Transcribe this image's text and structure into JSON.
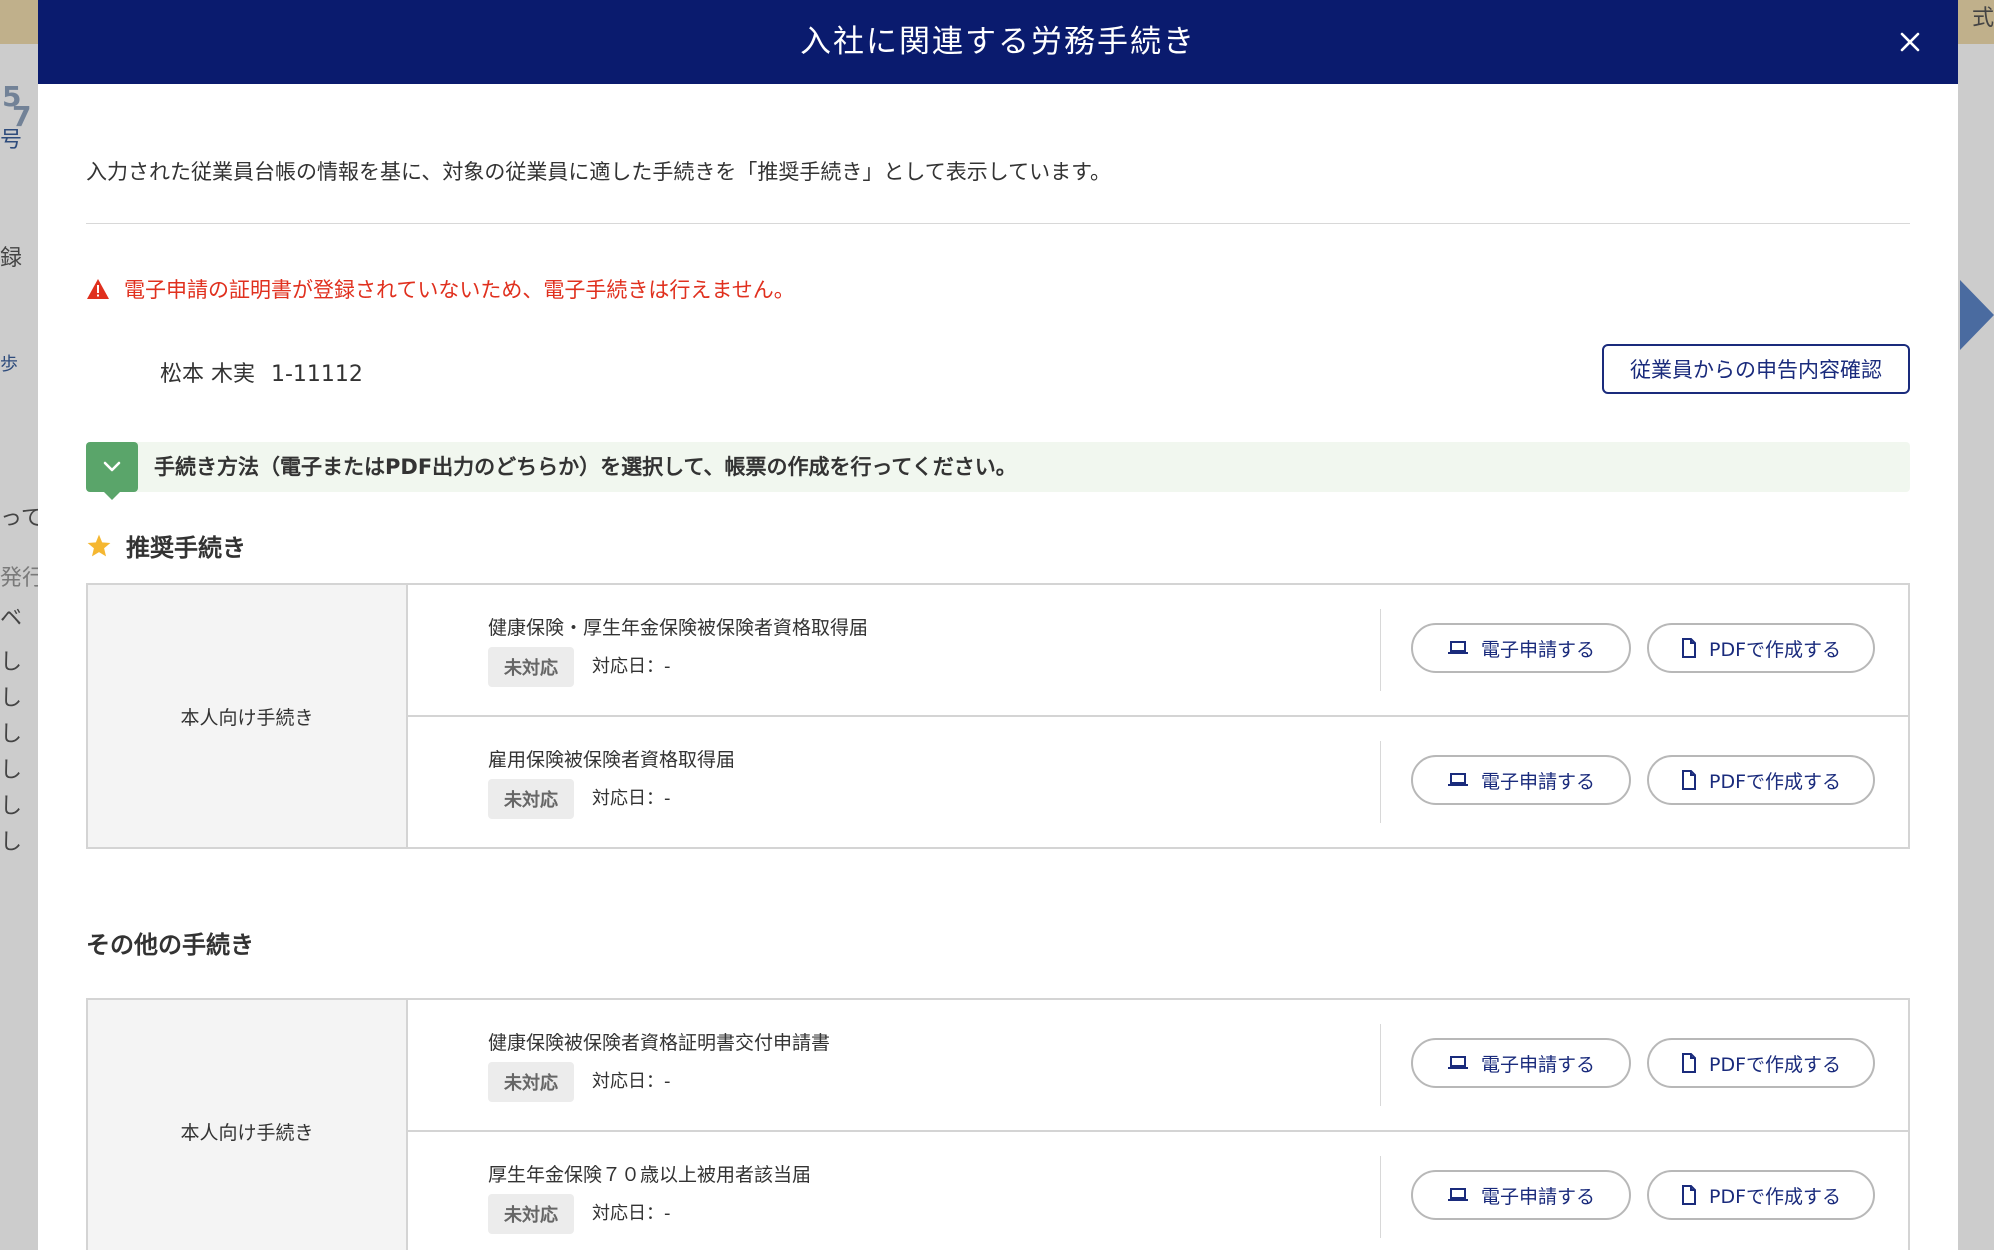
{
  "colors": {
    "header_bg": "#0a1b6e",
    "accent": "#1a2b7c",
    "warning": "#e0301e",
    "success": "#5aa56a",
    "star": "#f5b731"
  },
  "background": {
    "fragments": [
      "5",
      "7",
      "号",
      "録",
      "歩",
      "って",
      "発行",
      "ベ",
      "し",
      "し",
      "し",
      "し",
      "し",
      "し",
      "式",
      "≡"
    ]
  },
  "modal": {
    "title": "入社に関連する労務手続き",
    "close_icon": "close-icon",
    "intro": "入力された従業員台帳の情報を基に、対象の従業員に適した手続きを「推奨手続き」として表示しています。",
    "warning": "電子申請の証明書が登録されていないため、電子手続きは行えません。",
    "employee": {
      "name": "松本 木実",
      "id": "1-11112"
    },
    "confirm_button": "従業員からの申告内容確認",
    "instruction": "手続き方法（電子またはPDF出力のどちらか）を選択して、帳票の作成を行ってください。",
    "recommended": {
      "title": "推奨手続き",
      "category": "本人向け手続き",
      "procedures": [
        {
          "name": "健康保険・厚生年金保険被保険者資格取得届",
          "status": "未対応",
          "date": "対応日：-",
          "electronic_label": "電子申請する",
          "pdf_label": "PDFで作成する"
        },
        {
          "name": "雇用保険被保険者資格取得届",
          "status": "未対応",
          "date": "対応日：-",
          "electronic_label": "電子申請する",
          "pdf_label": "PDFで作成する"
        }
      ]
    },
    "other": {
      "title": "その他の手続き",
      "category": "本人向け手続き",
      "procedures": [
        {
          "name": "健康保険被保険者資格証明書交付申請書",
          "status": "未対応",
          "date": "対応日：-",
          "electronic_label": "電子申請する",
          "pdf_label": "PDFで作成する"
        },
        {
          "name": "厚生年金保険７０歳以上被用者該当届",
          "status": "未対応",
          "date": "対応日：-",
          "electronic_label": "電子申請する",
          "pdf_label": "PDFで作成する"
        }
      ]
    }
  }
}
